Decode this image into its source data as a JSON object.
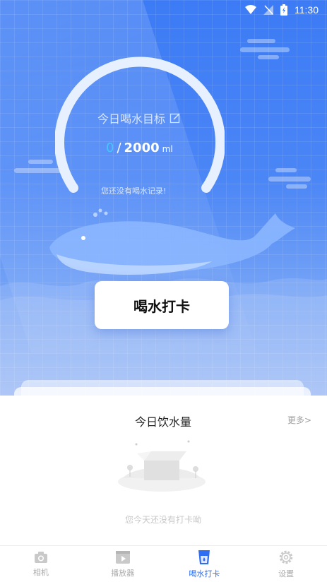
{
  "status_bar": {
    "time": "11:30"
  },
  "hero": {
    "goal_label": "今日喝水目标",
    "current_amount": "0",
    "separator": "/",
    "goal_amount": "2000",
    "unit": "ml",
    "no_record_text": "您还没有喝水记录!",
    "checkin_button_label": "喝水打卡"
  },
  "card": {
    "title": "今日饮水量",
    "more_label": "更多>",
    "empty_text": "您今天还没有打卡呦"
  },
  "tabs": [
    {
      "label": "相机",
      "icon": "camera-icon"
    },
    {
      "label": "播放器",
      "icon": "play-icon"
    },
    {
      "label": "喝水打卡",
      "icon": "cup-icon",
      "active": true
    },
    {
      "label": "设置",
      "icon": "gear-icon"
    }
  ],
  "colors": {
    "primary": "#3c7bf5",
    "accent_current": "#46c6ff",
    "active_tab": "#2f6ef0"
  }
}
